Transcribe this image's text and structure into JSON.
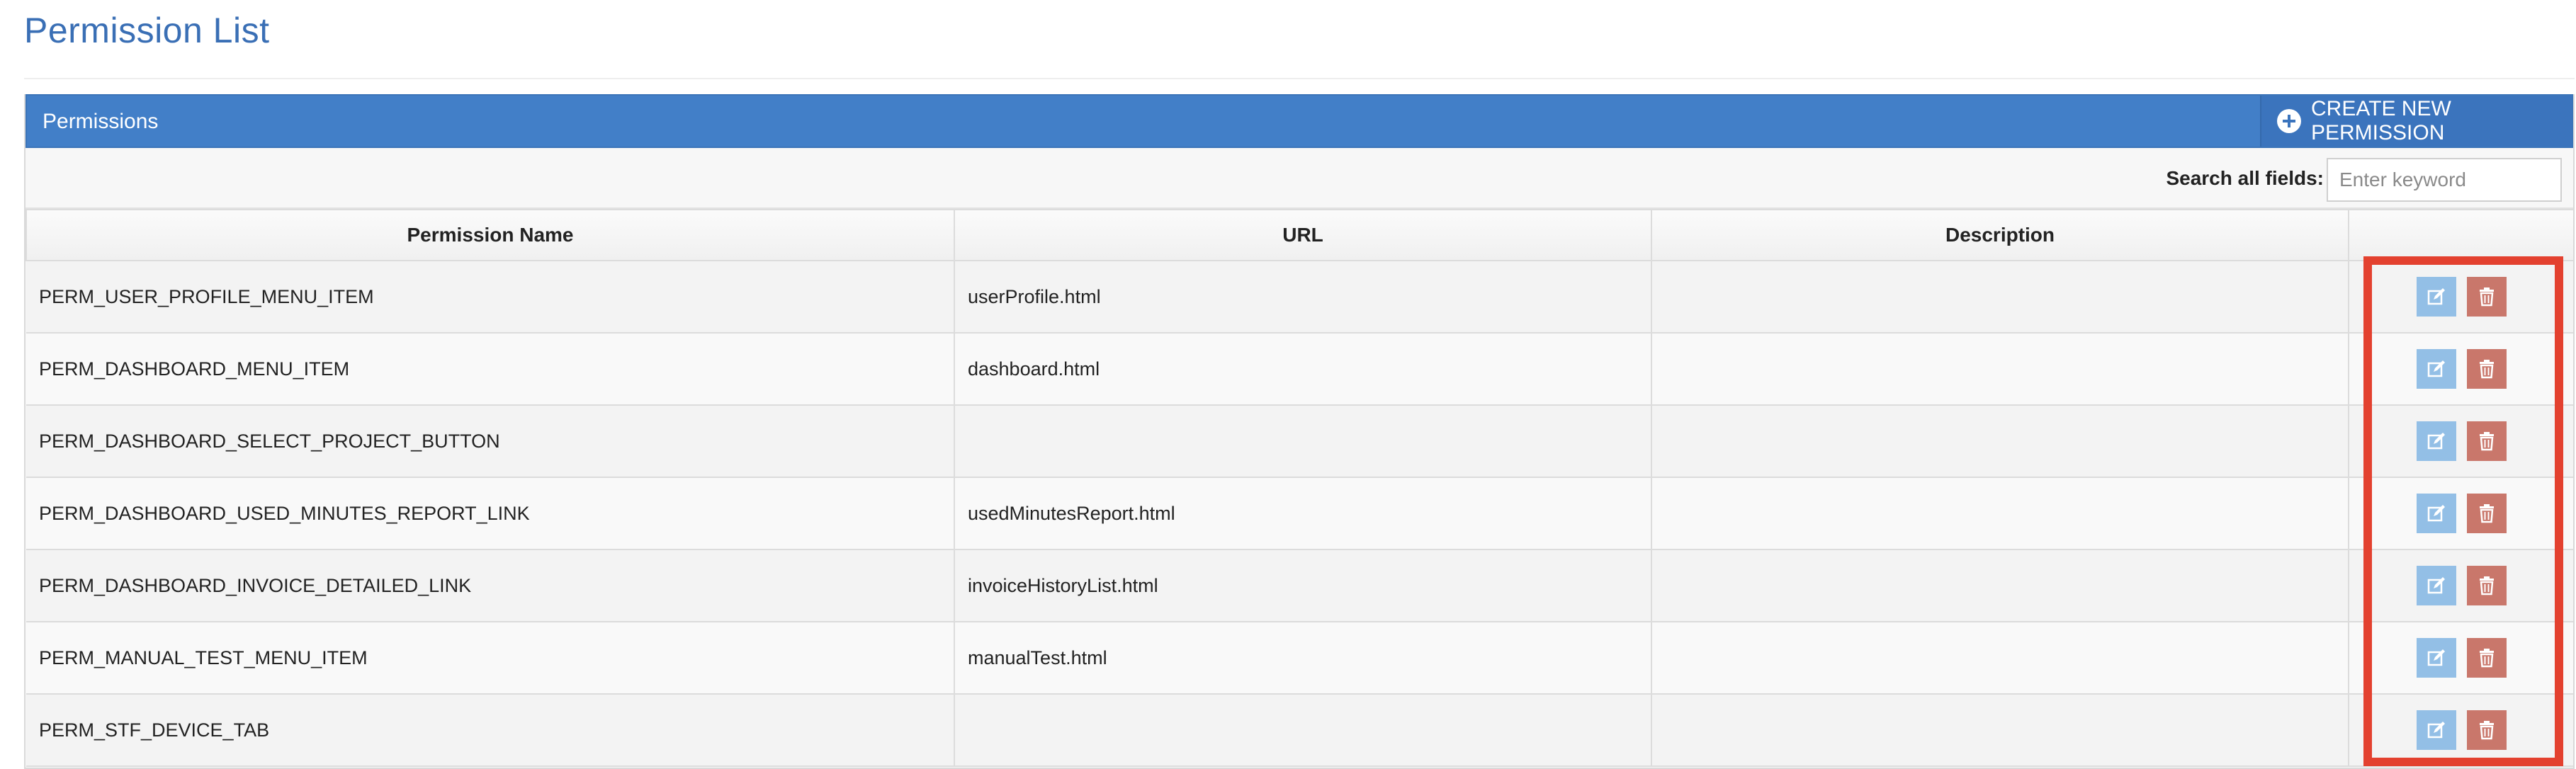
{
  "page": {
    "title": "Permission List"
  },
  "panel": {
    "title": "Permissions",
    "create_label": "CREATE NEW PERMISSION"
  },
  "search": {
    "label": "Search all fields:",
    "placeholder": "Enter keyword",
    "value": ""
  },
  "table": {
    "columns": [
      "Permission Name",
      "URL",
      "Description",
      ""
    ],
    "rows": [
      {
        "name": "PERM_USER_PROFILE_MENU_ITEM",
        "url": "userProfile.html",
        "description": ""
      },
      {
        "name": "PERM_DASHBOARD_MENU_ITEM",
        "url": "dashboard.html",
        "description": ""
      },
      {
        "name": "PERM_DASHBOARD_SELECT_PROJECT_BUTTON",
        "url": "",
        "description": ""
      },
      {
        "name": "PERM_DASHBOARD_USED_MINUTES_REPORT_LINK",
        "url": "usedMinutesReport.html",
        "description": ""
      },
      {
        "name": "PERM_DASHBOARD_INVOICE_DETAILED_LINK",
        "url": "invoiceHistoryList.html",
        "description": ""
      },
      {
        "name": "PERM_MANUAL_TEST_MENU_ITEM",
        "url": "manualTest.html",
        "description": ""
      },
      {
        "name": "PERM_STF_DEVICE_TAB",
        "url": "",
        "description": ""
      }
    ]
  },
  "icons": {
    "create": "plus-circle-icon",
    "edit": "edit-icon",
    "delete": "trash-icon"
  },
  "colors": {
    "title": "#3a6fb5",
    "header_bar": "#427fc8",
    "edit_button": "#93bfe6",
    "delete_button": "#c9776b",
    "highlight": "#e3412f"
  }
}
